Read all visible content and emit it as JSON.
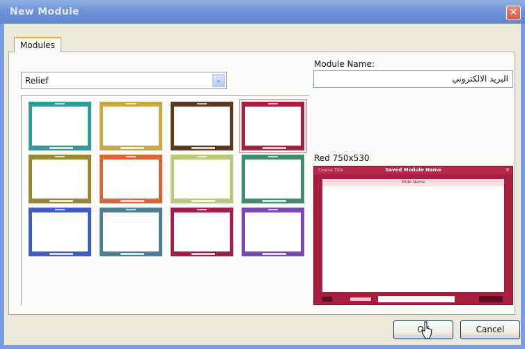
{
  "window": {
    "title": "New Module",
    "close_glyph": "✕"
  },
  "tabs": [
    {
      "label": "Modules"
    }
  ],
  "theme_select": {
    "value": "Relief",
    "arrow_glyph": "⌄"
  },
  "module_name": {
    "label": "Module Name:",
    "value": "البريد الالكتروني"
  },
  "preview": {
    "caption": "Red 750x530",
    "inner_title": "Saved Module Name",
    "inner_band": "Slide Name",
    "inner_left": "Course Title",
    "inner_close": "✕",
    "color": "#a81e3e"
  },
  "themes": [
    {
      "name": "teal",
      "color": "#2e9c9a"
    },
    {
      "name": "gold",
      "color": "#c9a845"
    },
    {
      "name": "brown",
      "color": "#5b3a1e"
    },
    {
      "name": "red",
      "color": "#a8203f",
      "selected": true
    },
    {
      "name": "olive",
      "color": "#9a8734"
    },
    {
      "name": "orange",
      "color": "#d9663a"
    },
    {
      "name": "lime",
      "color": "#bac978"
    },
    {
      "name": "green",
      "color": "#3f8c6e"
    },
    {
      "name": "blue",
      "color": "#3f5bc4"
    },
    {
      "name": "slate",
      "color": "#4d7f94"
    },
    {
      "name": "crimson",
      "color": "#a31c4a"
    },
    {
      "name": "purple",
      "color": "#7a48b8"
    }
  ],
  "buttons": {
    "ok": "OK",
    "cancel": "Cancel"
  }
}
